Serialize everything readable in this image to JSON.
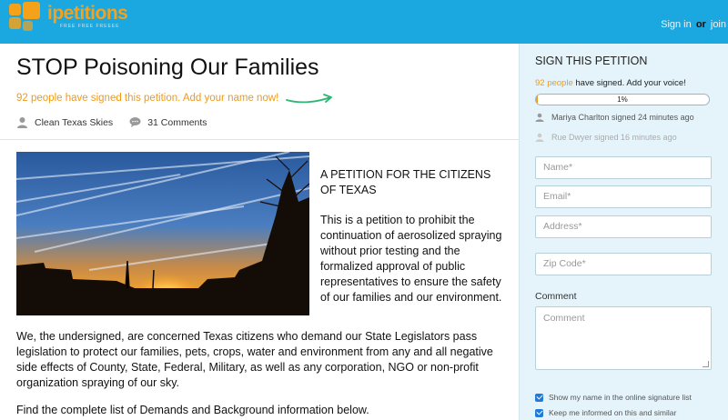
{
  "brand": {
    "name": "ipetitions",
    "tagline": "FREE FREE FREEEE"
  },
  "header": {
    "sign_in": "Sign in",
    "or": "or",
    "join": "join"
  },
  "petition": {
    "title": "STOP Poisoning Our Families",
    "signed_banner": "92 people have signed this petition. Add your name now!",
    "author": "Clean Texas Skies",
    "comments": "31 Comments",
    "intro_heading": "A PETITION FOR THE CITIZENS OF TEXAS",
    "intro_body": "This is a petition to prohibit the continuation of aerosolized spraying without prior testing and the formalized approval of public representatives to ensure the safety of our families and our environment.",
    "statement": "We, the undersigned, are concerned Texas citizens who demand our State Legislators pass legislation to protect our families, pets, crops, water and environment from any and all negative side effects of County, State, Federal, Military, as well as any corporation, NGO or non-profit organization spraying of our sky.",
    "footer_line": "Find the complete list of Demands and Background information below."
  },
  "sidebar": {
    "title": "SIGN THIS PETITION",
    "signed_count": "92 people",
    "signed_suffix": " have signed. Add your voice!",
    "progress_label": "1%",
    "progress_value": 0.01,
    "recent_signers": [
      "Mariya Charlton signed 24 minutes ago",
      "Rue Dwyer signed 16 minutes ago"
    ],
    "form": {
      "name_placeholder": "Name*",
      "email_placeholder": "Email*",
      "address_placeholder": "Address*",
      "zip_placeholder": "Zip Code*",
      "comment_label": "Comment",
      "comment_placeholder": "Comment"
    },
    "checkboxes": [
      {
        "label": "Show my name in the online signature list",
        "checked": true
      },
      {
        "label": "Keep me informed on this and similar",
        "checked": true
      }
    ]
  },
  "colors": {
    "header": "#1ba8e0",
    "accent": "#f29a12",
    "sidebar": "#e5f4fb",
    "checkbox": "#1f7ad8"
  },
  "icons": {
    "author": "user-icon",
    "comments": "comment-bubble-icon",
    "signer": "user-icon",
    "arrow": "curved-arrow-icon"
  }
}
